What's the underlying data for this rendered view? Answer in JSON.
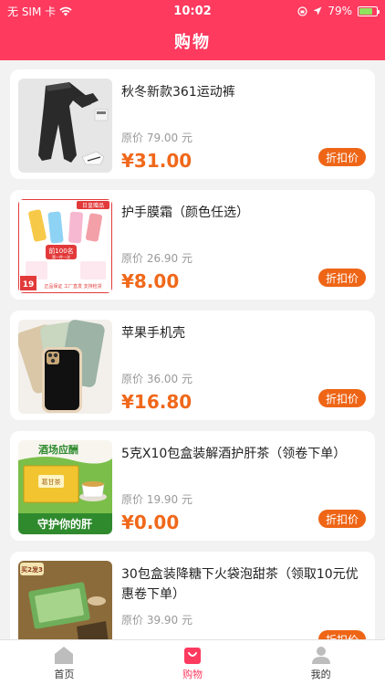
{
  "status": {
    "carrier": "无 SIM 卡",
    "time": "10:02",
    "battery": "79%",
    "battery_level": 0.79
  },
  "nav": {
    "title": "购物"
  },
  "products": [
    {
      "title": "秋冬新款361运动裤",
      "original": "原价  79.00 元",
      "price": "¥31.00",
      "button": "折扣价",
      "image": "sport-pants"
    },
    {
      "title": "护手膜霜（颜色任选）",
      "original": "原价  26.90 元",
      "price": "¥8.00",
      "button": "折扣价",
      "image": "hand-cream",
      "image_text": {
        "top": "日皇赠品",
        "mid": "前100名",
        "sub": "第一件一次",
        "price": "19",
        "bottom": "正品保证  工厂直发  支持检货"
      }
    },
    {
      "title": "苹果手机壳",
      "original": "原价  36.00 元",
      "price": "¥16.80",
      "button": "折扣价",
      "image": "phone-case"
    },
    {
      "title": "5克X10包盒装解酒护肝茶（领卷下单）",
      "original": "原价  19.90 元",
      "price": "¥0.00",
      "button": "折扣价",
      "image": "liver-tea",
      "image_text": {
        "top": "酒场应酬",
        "box": "葛甘茶",
        "bottom": "守护你的肝"
      }
    },
    {
      "title": "30包盒装降糖下火袋泡甜茶（领取10元优惠卷下单）",
      "original": "原价  39.90 元",
      "price": "",
      "button": "折扣价",
      "image": "sweet-tea",
      "image_text": {
        "badge": "买2发3"
      }
    }
  ],
  "tabs": [
    {
      "label": "首页",
      "icon": "home-icon",
      "active": false
    },
    {
      "label": "购物",
      "icon": "shopping-bag-icon",
      "active": true
    },
    {
      "label": "我的",
      "icon": "user-icon",
      "active": false
    }
  ],
  "colors": {
    "brand": "#fe3a5f",
    "price": "#f0681a",
    "button": "#ee6516"
  }
}
